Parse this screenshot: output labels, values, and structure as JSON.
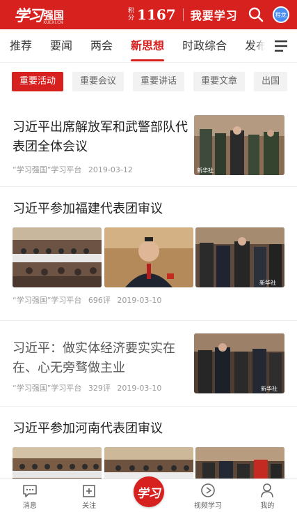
{
  "header": {
    "logo_script": "学习",
    "logo_cn": "强国",
    "logo_url": "XUEXI.CN",
    "score_label_top": "积",
    "score_label_bottom": "分",
    "score_value": "1167",
    "study_label": "我要学习",
    "avatar_text": "程龙",
    "brand_color": "#d7211e"
  },
  "tabs": [
    {
      "label": "推荐",
      "active": false
    },
    {
      "label": "要闻",
      "active": false
    },
    {
      "label": "两会",
      "active": false
    },
    {
      "label": "新思想",
      "active": true
    },
    {
      "label": "时政综合",
      "active": false
    },
    {
      "label": "发布",
      "active": false
    }
  ],
  "sub_tabs": [
    {
      "label": "重要活动",
      "active": true
    },
    {
      "label": "重要会议",
      "active": false
    },
    {
      "label": "重要讲话",
      "active": false
    },
    {
      "label": "重要文章",
      "active": false
    },
    {
      "label": "出国",
      "active": false
    }
  ],
  "news": [
    {
      "title": "习近平出席解放军和武警部队代表团全体会议",
      "source": "“学习强国”学习平台",
      "comments": "",
      "date": "2019-03-12",
      "watermark": "新华社"
    },
    {
      "title": "习近平参加福建代表团审议",
      "source": "“学习强国”学习平台",
      "comments": "696评",
      "date": "2019-03-10",
      "watermark": "新华社"
    },
    {
      "title": "习近平：做实体经济要实实在在、心无旁骛做主业",
      "source": "“学习强国”学习平台",
      "comments": "329评",
      "date": "2019-03-10",
      "watermark": "新华社"
    },
    {
      "title": "习近平参加河南代表团审议"
    }
  ],
  "bottom_nav": {
    "messages": "消息",
    "follow": "关注",
    "center": "学习",
    "video": "视频学习",
    "mine": "我的"
  }
}
